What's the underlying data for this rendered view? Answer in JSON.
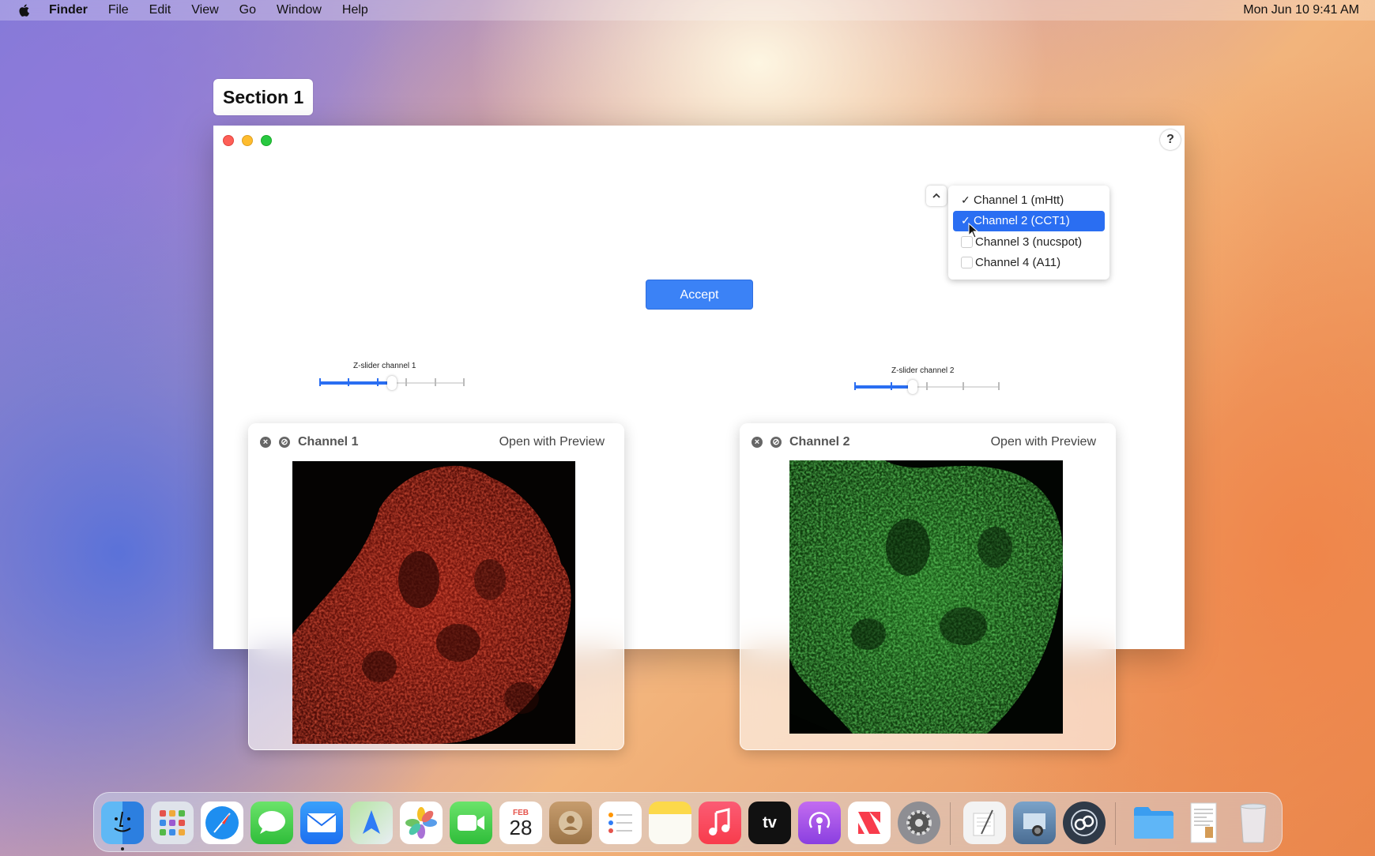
{
  "menubar": {
    "app": "Finder",
    "items": [
      "File",
      "Edit",
      "View",
      "Go",
      "Window",
      "Help"
    ],
    "clock": "Mon Jun 10  9:41 AM"
  },
  "section_label": "Section 1",
  "window": {
    "help": "?",
    "accept_label": "Accept",
    "caret": "⌃",
    "dropdown": [
      {
        "label": "Channel 1 (mHtt)",
        "checked": true,
        "selected": false
      },
      {
        "label": "Channel 2 (CCT1)",
        "checked": true,
        "selected": true
      },
      {
        "label": "Channel  3 (nucspot)",
        "checked": false,
        "selected": false
      },
      {
        "label": "Channel 4 (A11)",
        "checked": false,
        "selected": false
      }
    ],
    "slider1": {
      "label": "Z-slider channel 1",
      "value_fraction": 0.5,
      "ticks": 6
    },
    "slider2": {
      "label": "Z-slider channel 2",
      "value_fraction": 0.4,
      "ticks": 5
    }
  },
  "panels": [
    {
      "title": "Channel 1",
      "open_label": "Open with Preview",
      "color": "#c4271a"
    },
    {
      "title": "Channel 2",
      "open_label": "Open with Preview",
      "color": "#2f9a2a"
    }
  ],
  "dock": {
    "calendar_month": "FEB",
    "calendar_day": "28",
    "apps": [
      "finder-icon",
      "launchpad-icon",
      "safari-icon",
      "messages-icon",
      "mail-icon",
      "maps-icon",
      "photos-icon",
      "facetime-icon",
      "calendar-icon",
      "contacts-icon",
      "reminders-icon",
      "notes-icon",
      "music-icon",
      "tv-icon",
      "podcasts-icon",
      "news-icon",
      "system-settings-icon",
      "textedit-icon",
      "preview-icon",
      "screen-sharing-icon",
      "folder-icon",
      "document-icon",
      "trash-icon"
    ],
    "tv_label": "tv"
  }
}
